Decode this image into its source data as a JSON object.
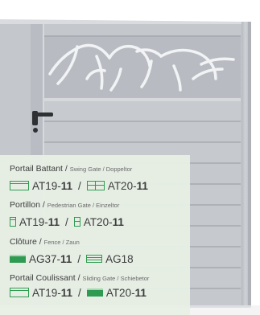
{
  "sections": [
    {
      "title": "Portail Battant",
      "subtitle": "Swing Gate / Doppeltor",
      "items": [
        {
          "icon": "board-icon",
          "code_prefix": "AT19-",
          "code_bold": "11"
        },
        {
          "icon": "board-split-icon",
          "code_prefix": "AT20-",
          "code_bold": "11"
        }
      ]
    },
    {
      "title": "Portillon",
      "subtitle": "Pedestrian Gate / Einzeltor",
      "items": [
        {
          "icon": "post-icon",
          "code_prefix": "AT19-",
          "code_bold": "11"
        },
        {
          "icon": "post-split-icon",
          "code_prefix": "AT20-",
          "code_bold": "11"
        }
      ]
    },
    {
      "title": "Clôture",
      "subtitle": "Fence / Zaun",
      "items": [
        {
          "icon": "fill-board-icon",
          "code_prefix": "AG37-",
          "code_bold": "11"
        },
        {
          "icon": "lines-board-icon",
          "code_prefix": "AG18",
          "code_bold": ""
        }
      ]
    },
    {
      "title": "Portail Coulissant",
      "subtitle": "Sliding Gate / Schiebetor",
      "items": [
        {
          "icon": "board-icon",
          "code_prefix": "AT19-",
          "code_bold": "11"
        },
        {
          "icon": "fill-board-icon",
          "code_prefix": "AT20-",
          "code_bold": "11"
        }
      ]
    }
  ],
  "separator": "/",
  "colors": {
    "accent": "#2f9a51",
    "gate": "#c9ccd1",
    "panel": "#e8f0e6"
  }
}
